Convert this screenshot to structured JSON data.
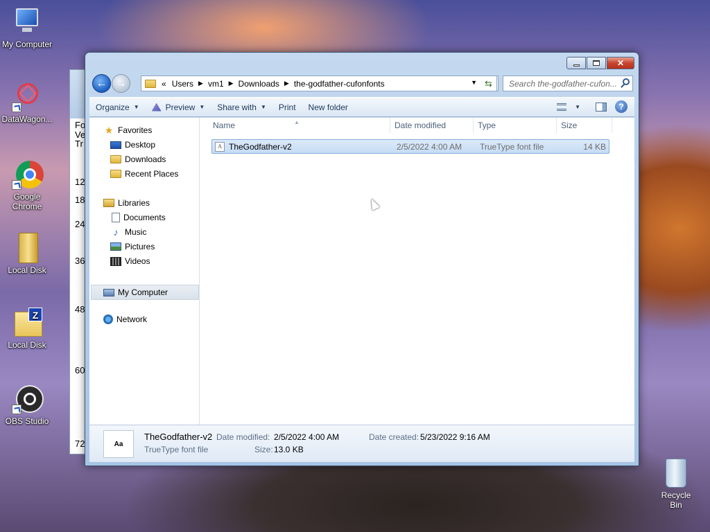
{
  "desktop": {
    "icons": [
      {
        "label": "My Computer"
      },
      {
        "label": "DataWagon..."
      },
      {
        "label": "Google Chrome"
      },
      {
        "label": "Local Disk"
      },
      {
        "label": "Local Disk"
      },
      {
        "label": "OBS Studio"
      }
    ],
    "recycle_bin": "Recycle Bin"
  },
  "bg_window": {
    "text_lines": [
      "Fo",
      "Ve",
      "Tr"
    ],
    "numbers": [
      "12",
      "18",
      "24",
      "36",
      "48",
      "60",
      "72"
    ]
  },
  "window": {
    "address": {
      "chevron": "«",
      "crumbs": [
        "Users",
        "vm1",
        "Downloads",
        "the-godfather-cufonfonts"
      ]
    },
    "search_placeholder": "Search the-godfather-cufon...",
    "toolbar": {
      "organize": "Organize",
      "preview": "Preview",
      "share_with": "Share with",
      "print": "Print",
      "new_folder": "New folder"
    },
    "nav": {
      "favorites": "Favorites",
      "desktop": "Desktop",
      "downloads": "Downloads",
      "recent_places": "Recent Places",
      "libraries": "Libraries",
      "documents": "Documents",
      "music": "Music",
      "pictures": "Pictures",
      "videos": "Videos",
      "my_computer": "My Computer",
      "network": "Network"
    },
    "columns": {
      "name": "Name",
      "date_modified": "Date modified",
      "type": "Type",
      "size": "Size"
    },
    "files": [
      {
        "name": "TheGodfather-v2",
        "date_modified": "2/5/2022 4:00 AM",
        "type": "TrueType font file",
        "size": "14 KB"
      }
    ],
    "details": {
      "name": "TheGodfather-v2",
      "type": "TrueType font file",
      "date_modified_label": "Date modified:",
      "date_modified": "2/5/2022 4:00 AM",
      "size_label": "Size:",
      "size": "13.0 KB",
      "date_created_label": "Date created:",
      "date_created": "5/23/2022 9:16 AM"
    }
  }
}
